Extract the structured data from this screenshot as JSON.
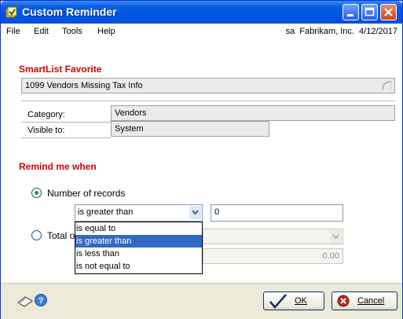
{
  "window": {
    "title": "Custom Reminder"
  },
  "menu": {
    "items": [
      "File",
      "Edit",
      "Tools",
      "Help"
    ],
    "company_info": "sa  Fabrikam, Inc.  4/12/2017"
  },
  "smartlist": {
    "section_title": "SmartList Favorite",
    "favorite_name": "1099 Vendors Missing Tax Info",
    "category_label": "Category:",
    "category_value": "Vendors",
    "visible_label": "Visible to:",
    "visible_value": "System"
  },
  "remind": {
    "section_title": "Remind me when",
    "option_records_label": "Number of records",
    "option_total_label": "Total o",
    "condition_selected": "is greater than",
    "record_count": "0",
    "total_amount": "0.00",
    "condition_options": [
      "is equal to",
      "is greater than",
      "is less than",
      "is not equal to"
    ]
  },
  "buttons": {
    "ok_label": "OK",
    "cancel_label": "Cancel"
  },
  "icons": {
    "app": "reminder-app-icon",
    "note": "note-icon",
    "help": "help-icon",
    "ok": "checkmark-icon",
    "cancel": "cancel-icon"
  },
  "colors": {
    "section_title": "#d20000",
    "selection": "#316ac5",
    "titlebar": "#0054e3"
  }
}
